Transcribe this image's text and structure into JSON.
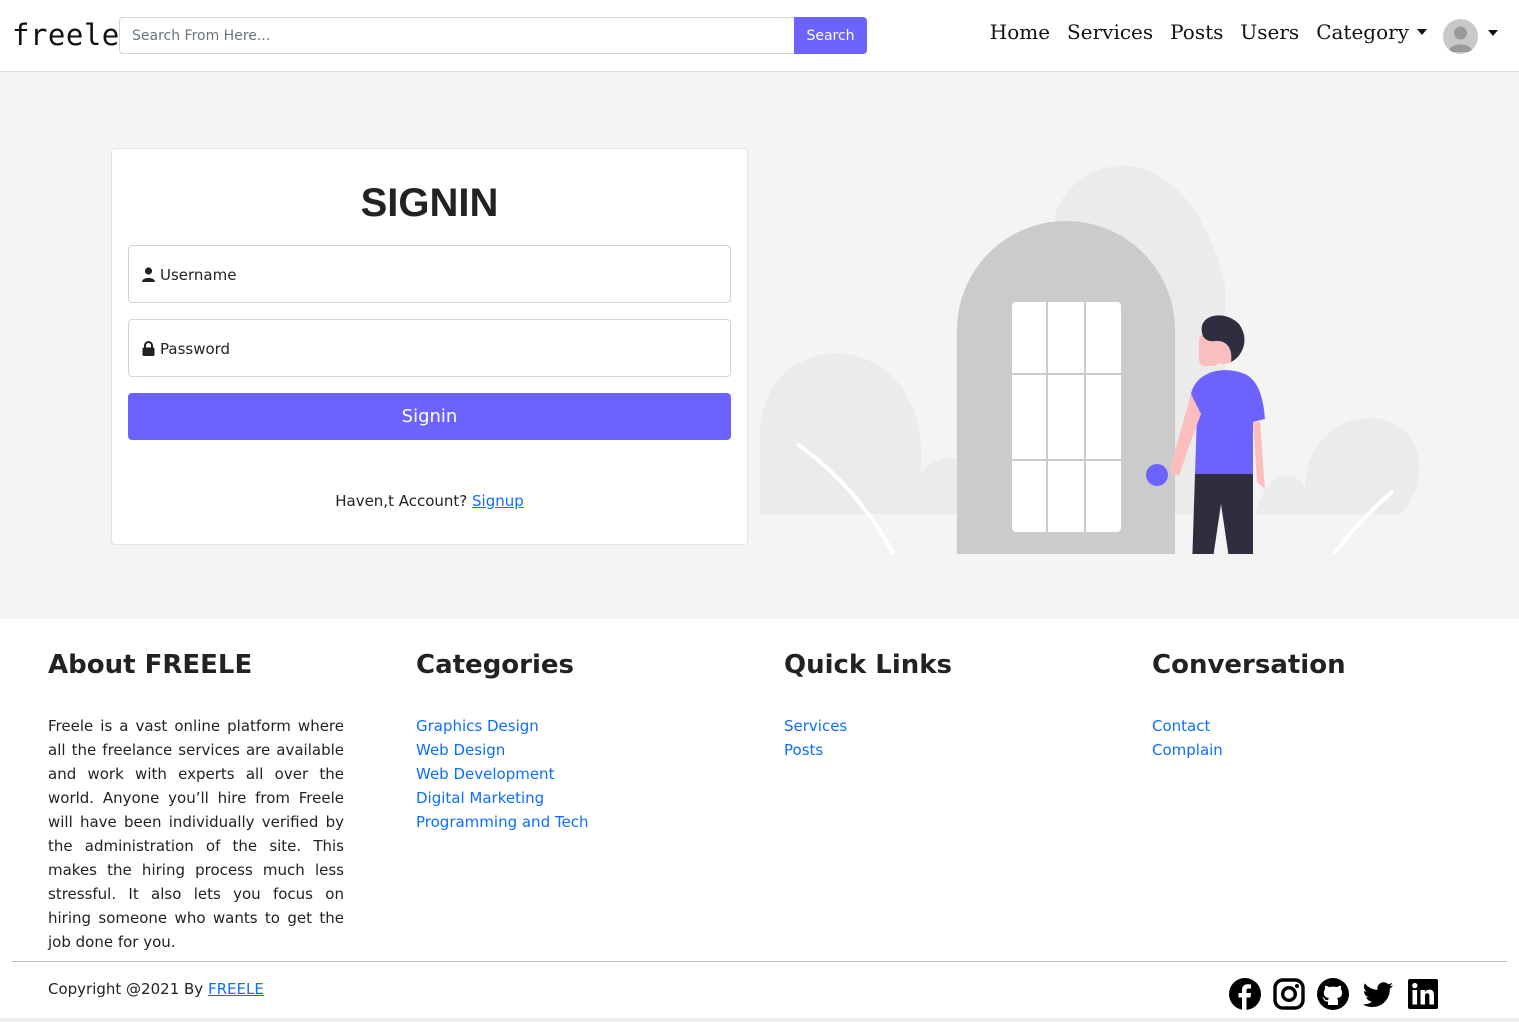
{
  "navbar": {
    "brand": "freele",
    "search_placeholder": "Search From Here...",
    "search_button": "Search",
    "links": [
      "Home",
      "Services",
      "Posts",
      "Users"
    ],
    "category_label": "Category"
  },
  "signin": {
    "title": "SIGNIN",
    "username_placeholder": "Username",
    "password_placeholder": "Password",
    "button": "Signin",
    "no_account_text": "Haven,t Account?",
    "signup_link": "Signup"
  },
  "footer": {
    "about": {
      "title": "About FREELE",
      "text": "Freele is a vast online platform where all the freelance services are available and work with experts all over the world. Anyone you’ll hire from Freele will have been individually verified by the administration of the site. This makes the hiring process much less stressful. It also lets you focus on hiring someone who wants to get the job done for you."
    },
    "categories": {
      "title": "Categories",
      "items": [
        "Graphics Design",
        "Web Design",
        "Web Development",
        "Digital Marketing",
        "Programming and Tech"
      ]
    },
    "quick_links": {
      "title": "Quick Links",
      "items": [
        "Services",
        "Posts"
      ]
    },
    "conversation": {
      "title": "Conversation",
      "items": [
        "Contact",
        "Complain"
      ]
    },
    "copyright_text": "Copyright @2021 By",
    "copyright_link": "FREELE",
    "social_icons": [
      "facebook-icon",
      "instagram-icon",
      "github-icon",
      "twitter-icon",
      "linkedin-icon"
    ]
  },
  "colors": {
    "accent": "#6c63ff",
    "link": "#0d6efd",
    "background": "#f4f4f4"
  }
}
